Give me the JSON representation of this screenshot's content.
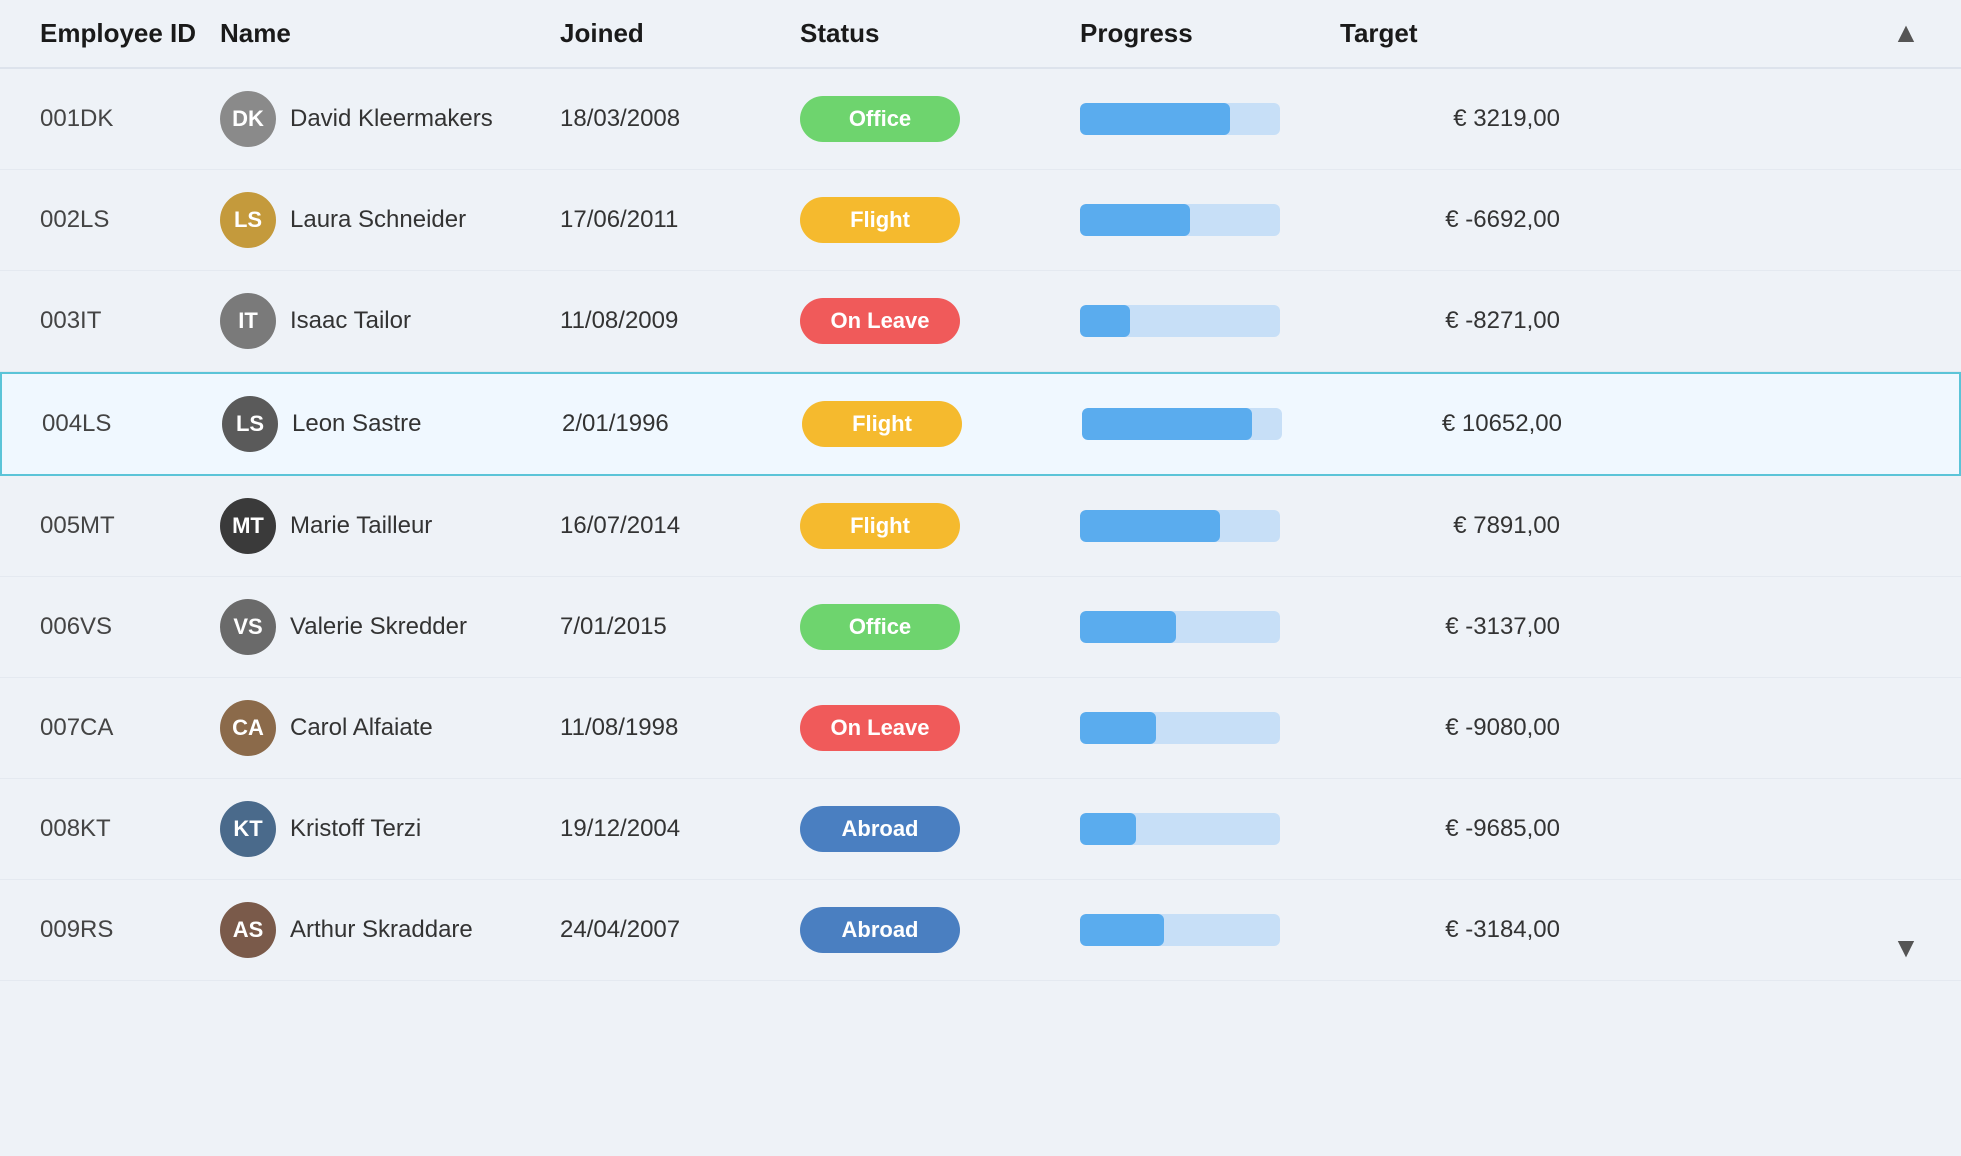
{
  "header": {
    "columns": [
      "Employee ID",
      "Name",
      "Joined",
      "Status",
      "Progress",
      "Target"
    ]
  },
  "rows": [
    {
      "id": "001DK",
      "name": "David Kleermakers",
      "avatar_initials": "DK",
      "avatar_color": "#8a8a8a",
      "joined": "18/03/2008",
      "status": "Office",
      "status_type": "office",
      "progress": 75,
      "target": "€ 3219,00",
      "target_type": "positive",
      "selected": false
    },
    {
      "id": "002LS",
      "name": "Laura Schneider",
      "avatar_initials": "LS",
      "avatar_color": "#c49a3c",
      "joined": "17/06/2011",
      "status": "Flight",
      "status_type": "flight",
      "progress": 55,
      "target": "€ -6692,00",
      "target_type": "negative",
      "selected": false
    },
    {
      "id": "003IT",
      "name": "Isaac Tailor",
      "avatar_initials": "IT",
      "avatar_color": "#7a7a7a",
      "joined": "11/08/2009",
      "status": "On Leave",
      "status_type": "on-leave",
      "progress": 25,
      "target": "€ -8271,00",
      "target_type": "negative",
      "selected": false
    },
    {
      "id": "004LS",
      "name": "Leon Sastre",
      "avatar_initials": "LS",
      "avatar_color": "#5a5a5a",
      "joined": "2/01/1996",
      "status": "Flight",
      "status_type": "flight",
      "progress": 85,
      "target": "€ 10652,00",
      "target_type": "positive",
      "selected": true
    },
    {
      "id": "005MT",
      "name": "Marie Tailleur",
      "avatar_initials": "MT",
      "avatar_color": "#3a3a3a",
      "joined": "16/07/2014",
      "status": "Flight",
      "status_type": "flight",
      "progress": 70,
      "target": "€ 7891,00",
      "target_type": "positive",
      "selected": false
    },
    {
      "id": "006VS",
      "name": "Valerie Skredder",
      "avatar_initials": "VS",
      "avatar_color": "#6a6a6a",
      "joined": "7/01/2015",
      "status": "Office",
      "status_type": "office",
      "progress": 48,
      "target": "€ -3137,00",
      "target_type": "negative",
      "selected": false
    },
    {
      "id": "007CA",
      "name": "Carol Alfaiate",
      "avatar_initials": "CA",
      "avatar_color": "#8b6a4a",
      "joined": "11/08/1998",
      "status": "On Leave",
      "status_type": "on-leave",
      "progress": 38,
      "target": "€ -9080,00",
      "target_type": "negative",
      "selected": false
    },
    {
      "id": "008KT",
      "name": "Kristoff Terzi",
      "avatar_initials": "KT",
      "avatar_color": "#4a6a8b",
      "joined": "19/12/2004",
      "status": "Abroad",
      "status_type": "abroad",
      "progress": 28,
      "target": "€ -9685,00",
      "target_type": "negative",
      "selected": false
    },
    {
      "id": "009RS",
      "name": "Arthur Skraddare",
      "avatar_initials": "AS",
      "avatar_color": "#7a5a4a",
      "joined": "24/04/2007",
      "status": "Abroad",
      "status_type": "abroad",
      "progress": 42,
      "target": "€ -3184,00",
      "target_type": "negative",
      "selected": false
    }
  ],
  "scroll_up_icon": "▲",
  "scroll_down_icon": "▼"
}
